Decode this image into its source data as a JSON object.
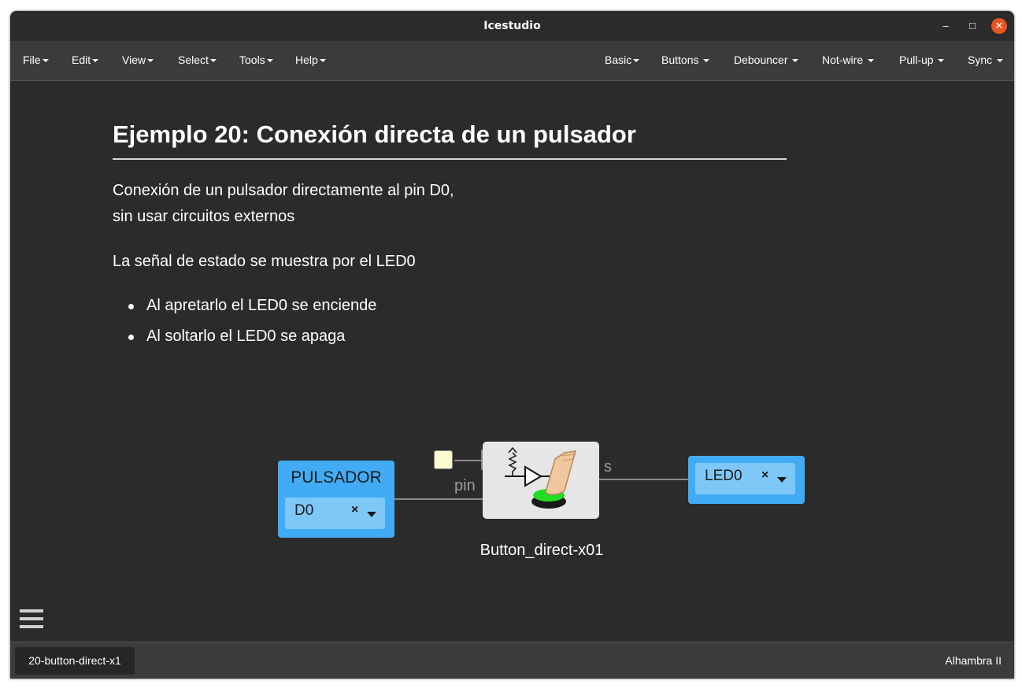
{
  "window": {
    "title": "Icestudio",
    "minimize": "–",
    "maximize": "□",
    "close": "✕"
  },
  "menu_left": [
    {
      "label": "File"
    },
    {
      "label": "Edit"
    },
    {
      "label": "View"
    },
    {
      "label": "Select"
    },
    {
      "label": "Tools"
    },
    {
      "label": "Help"
    }
  ],
  "menu_right": [
    {
      "label": "Basic"
    },
    {
      "label": "Buttons"
    },
    {
      "label": "Debouncer"
    },
    {
      "label": "Not-wire"
    },
    {
      "label": "Pull-up"
    },
    {
      "label": "Sync"
    }
  ],
  "doc": {
    "title": "Ejemplo 20: Conexión directa de un pulsador",
    "line1": "Conexión de un pulsador directamente al pin D0,",
    "line2": "sin usar circuitos externos",
    "line3": "La señal de estado se muestra por el LED0",
    "bullets": [
      "Al apretarlo el LED0 se enciende",
      "Al soltarlo el LED0 se apaga"
    ]
  },
  "circuit": {
    "input_block": {
      "title": "PULSADOR",
      "pin": "D0",
      "remove": "×"
    },
    "output_block": {
      "pin": "LED0",
      "remove": "×"
    },
    "module_name": "Button_direct-x01",
    "port_in_label": "pin",
    "port_out_label": "s"
  },
  "statusbar": {
    "file_tab": "20-button-direct-x1",
    "board": "Alhambra II"
  },
  "colors": {
    "block_blue": "#41acf5",
    "close_button": "#e95420",
    "led_green": "#22dd22"
  }
}
